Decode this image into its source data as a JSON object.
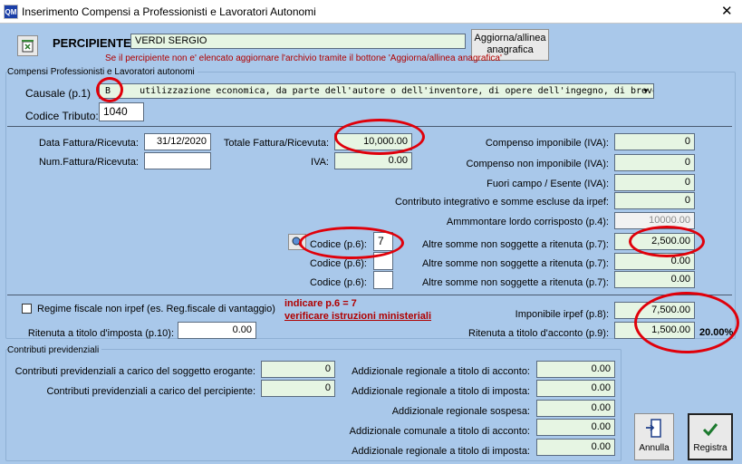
{
  "window": {
    "title": "Inserimento Compensi a Professionisti e Lavoratori Autonomi",
    "app_icon_text": "QM"
  },
  "percipiente": {
    "label": "PERCIPIENTE:",
    "value": "VERDI SERGIO",
    "update_button": "Aggiorna/allinea anagrafica",
    "note": "Se il percipiente non e' elencato aggiornare l'archivio tramite il bottone 'Aggiorna/allinea anagrafica'"
  },
  "section_compensi": {
    "title": "Compensi Professionisti e Lavoratori autonomi",
    "causale_label": "Causale (p.1)",
    "causale_code": "B",
    "causale_text": "utilizzazione economica, da parte dell'autore o dell'inventore, di opere dell'ingegno, di brevetti i",
    "codice_tributo_label": "Codice Tributo:",
    "codice_tributo": "1040"
  },
  "fattura": {
    "data_label": "Data Fattura/Ricevuta:",
    "data": "31/12/2020",
    "num_label": "Num.Fattura/Ricevuta:",
    "num": "",
    "totale_label": "Totale Fattura/Ricevuta:",
    "totale": "10,000.00",
    "iva_label": "IVA:",
    "iva": "0.00"
  },
  "right_fields": {
    "compenso_imponibile_label": "Compenso imponibile (IVA):",
    "compenso_imponibile": "0",
    "compenso_non_imponibile_label": "Compenso non imponibile (IVA):",
    "compenso_non_imponibile": "0",
    "fuori_campo_label": "Fuori campo / Esente (IVA):",
    "fuori_campo": "0",
    "contributo_label": "Contributo integrativo e somme escluse da irpef:",
    "contributo": "0",
    "ammontare_label": "Ammmontare lordo corrisposto (p.4):",
    "ammontare": "10000.00",
    "altre_label": "Altre somme non soggette a ritenuta (p.7):",
    "altre_1": "2,500.00",
    "altre_2": "0.00",
    "altre_3": "0.00"
  },
  "codici": {
    "label_1": "Codice (p.6):",
    "value_1": "7",
    "label_2": "Codice (p.6):",
    "value_2": "",
    "label_3": "Codice (p.6):",
    "value_3": ""
  },
  "regime": {
    "checkbox_label": "Regime fiscale non irpef (es. Reg.fiscale di vantaggio)",
    "note_1": "indicare p.6 = 7",
    "note_2": "verificare istruzioni ministeriali",
    "ritenuta_imposta_label": "Ritenuta a titolo d'imposta (p.10):",
    "ritenuta_imposta": "0.00",
    "imponibile_label": "Imponibile irpef (p.8):",
    "imponibile": "7,500.00",
    "ritenuta_acconto_label": "Ritenuta a titolo d'acconto (p.9):",
    "ritenuta_acconto": "1,500.00",
    "percent": "20.00%"
  },
  "contributi": {
    "title": "Contributi previdenziali",
    "erogante_label": "Contributi previdenziali a carico del soggetto erogante:",
    "erogante": "0",
    "percipiente_label": "Contributi previdenziali a carico del percipiente:",
    "percipiente": "0",
    "add_reg_acconto_label": "Addizionale regionale a titolo di acconto:",
    "add_reg_acconto": "0.00",
    "add_reg_imposta_label": "Addizionale regionale a titolo di imposta:",
    "add_reg_imposta": "0.00",
    "add_reg_sospesa_label": "Addizionale regionale sospesa:",
    "add_reg_sospesa": "0.00",
    "add_com_acconto_label": "Addizionale comunale a titolo di acconto:",
    "add_com_acconto": "0.00",
    "add_reg_imposta2_label": "Addizionale regionale a titolo di imposta:",
    "add_reg_imposta2": "0.00"
  },
  "buttons": {
    "annulla": "Annulla",
    "registra": "Registra"
  }
}
